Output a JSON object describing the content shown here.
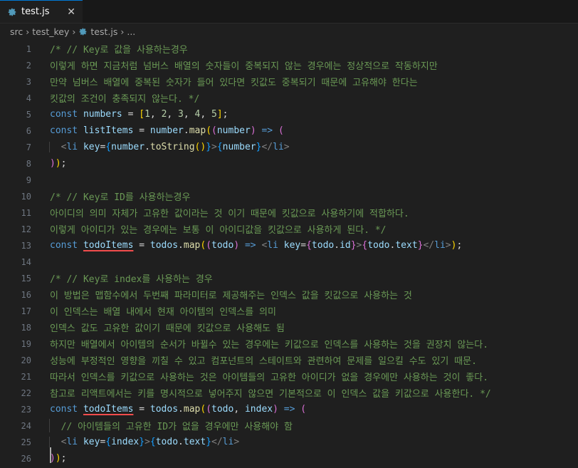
{
  "tab": {
    "label": "test.js",
    "close": "✕"
  },
  "breadcrumb": {
    "src": "src",
    "folder": "test_key",
    "file": "test.js",
    "more": "..."
  },
  "lines": [
    {
      "n": "1",
      "tokens": [
        [
          "cmt",
          "/* // Key로 값을 사용하는경우"
        ]
      ]
    },
    {
      "n": "2",
      "tokens": [
        [
          "cmt",
          "이렇게 하면 지금처럼 넘버스 배열의 숫자들이 중복되지 않는 경우에는 정상적으로 작동하지만"
        ]
      ]
    },
    {
      "n": "3",
      "tokens": [
        [
          "cmt",
          "만약 넘버스 배열에 중복된 숫자가 들어 있다면 킷값도 중복되기 때문에 고유해야 한다는"
        ]
      ]
    },
    {
      "n": "4",
      "tokens": [
        [
          "cmt",
          "킷값의 조건이 충족되지 않는다. */"
        ]
      ]
    },
    {
      "n": "5",
      "tokens": [
        [
          "kw",
          "const "
        ],
        [
          "var",
          "numbers"
        ],
        [
          "plain",
          " = "
        ],
        [
          "b1",
          "["
        ],
        [
          "num",
          "1"
        ],
        [
          "plain",
          ", "
        ],
        [
          "num",
          "2"
        ],
        [
          "plain",
          ", "
        ],
        [
          "num",
          "3"
        ],
        [
          "plain",
          ", "
        ],
        [
          "num",
          "4"
        ],
        [
          "plain",
          ", "
        ],
        [
          "num",
          "5"
        ],
        [
          "b1",
          "]"
        ],
        [
          "plain",
          ";"
        ]
      ]
    },
    {
      "n": "6",
      "tokens": [
        [
          "kw",
          "const "
        ],
        [
          "var",
          "listItems"
        ],
        [
          "plain",
          " = "
        ],
        [
          "var",
          "number"
        ],
        [
          "plain",
          "."
        ],
        [
          "fn",
          "map"
        ],
        [
          "b1",
          "("
        ],
        [
          "b2",
          "("
        ],
        [
          "var",
          "number"
        ],
        [
          "b2",
          ")"
        ],
        [
          "kw",
          " =>"
        ],
        [
          "plain",
          " "
        ],
        [
          "b2",
          "("
        ]
      ]
    },
    {
      "n": "7",
      "indent": true,
      "tokens": [
        [
          "plain",
          "  "
        ],
        [
          "tag",
          "<"
        ],
        [
          "tagname",
          "li"
        ],
        [
          "plain",
          " "
        ],
        [
          "attr",
          "key"
        ],
        [
          "plain",
          "="
        ],
        [
          "b3",
          "{"
        ],
        [
          "var",
          "number"
        ],
        [
          "plain",
          "."
        ],
        [
          "fn",
          "toString"
        ],
        [
          "b1",
          "()"
        ],
        [
          "b3",
          "}"
        ],
        [
          "tag",
          ">"
        ],
        [
          "b3",
          "{"
        ],
        [
          "var",
          "number"
        ],
        [
          "b3",
          "}"
        ],
        [
          "tag",
          "</"
        ],
        [
          "tagname",
          "li"
        ],
        [
          "tag",
          ">"
        ]
      ]
    },
    {
      "n": "8",
      "tokens": [
        [
          "b2",
          ")"
        ],
        [
          "b1",
          ")"
        ],
        [
          "plain",
          ";"
        ]
      ]
    },
    {
      "n": "9",
      "tokens": []
    },
    {
      "n": "10",
      "tokens": [
        [
          "cmt",
          "/* // Key로 ID를 사용하는경우"
        ]
      ]
    },
    {
      "n": "11",
      "tokens": [
        [
          "cmt",
          "아이디의 의미 자체가 고유한 값이라는 것 이기 때문에 킷값으로 사용하기에 적합하다."
        ]
      ]
    },
    {
      "n": "12",
      "tokens": [
        [
          "cmt",
          "이렇게 아이디가 있는 경우에는 보통 이 아이디값을 킷값으로 사용하게 된다. */"
        ]
      ]
    },
    {
      "n": "13",
      "tokens": [
        [
          "kw",
          "const "
        ],
        [
          "var err",
          "todoItems"
        ],
        [
          "plain",
          " = "
        ],
        [
          "var",
          "todos"
        ],
        [
          "plain",
          "."
        ],
        [
          "fn",
          "map"
        ],
        [
          "b1",
          "("
        ],
        [
          "b2",
          "("
        ],
        [
          "var",
          "todo"
        ],
        [
          "b2",
          ")"
        ],
        [
          "kw",
          " =>"
        ],
        [
          "plain",
          " "
        ],
        [
          "tag",
          "<"
        ],
        [
          "tagname",
          "li"
        ],
        [
          "plain",
          " "
        ],
        [
          "attr",
          "key"
        ],
        [
          "plain",
          "="
        ],
        [
          "b2",
          "{"
        ],
        [
          "var",
          "todo"
        ],
        [
          "plain",
          "."
        ],
        [
          "var",
          "id"
        ],
        [
          "b2",
          "}"
        ],
        [
          "tag",
          ">"
        ],
        [
          "b2",
          "{"
        ],
        [
          "var",
          "todo"
        ],
        [
          "plain",
          "."
        ],
        [
          "var",
          "text"
        ],
        [
          "b2",
          "}"
        ],
        [
          "tag",
          "</"
        ],
        [
          "tagname",
          "li"
        ],
        [
          "tag",
          ">"
        ],
        [
          "b1",
          ")"
        ],
        [
          "plain",
          ";"
        ]
      ]
    },
    {
      "n": "14",
      "tokens": []
    },
    {
      "n": "15",
      "tokens": [
        [
          "cmt",
          "/* // Key로 index를 사용하는 경우"
        ]
      ]
    },
    {
      "n": "16",
      "tokens": [
        [
          "cmt",
          "이 방법은 맵함수에서 두번째 파라미터로 제공해주는 인덱스 값을 킷값으로 사용하는 것"
        ]
      ]
    },
    {
      "n": "17",
      "tokens": [
        [
          "cmt",
          "이 인덱스는 배열 내에서 현재 아이템의 인덱스를 의미"
        ]
      ]
    },
    {
      "n": "18",
      "tokens": [
        [
          "cmt",
          "인덱스 값도 고유한 값이기 때문에 킷값으로 사용해도 됨"
        ]
      ]
    },
    {
      "n": "19",
      "tokens": [
        [
          "cmt",
          "하지만 배열에서 아이템의 순서가 바뀔수 있는 경우에는 키값으로 인덱스를 사용하는 것을 권장치 않는다."
        ]
      ]
    },
    {
      "n": "20",
      "tokens": [
        [
          "cmt",
          "성능에 부정적인 영향을 끼칠 수 있고 컴포넌트의 스테이트와 관련하여 문제를 일으킬 수도 있기 때문."
        ]
      ]
    },
    {
      "n": "21",
      "tokens": [
        [
          "cmt",
          "따라서 인덱스를 키값으로 사용하는 것은 아이템들의 고유한 아이디가 없을 경우에만 사용하는 것이 좋다."
        ]
      ]
    },
    {
      "n": "22",
      "tokens": [
        [
          "cmt",
          "참고로 리액트에서는 키를 명시적으로 넣어주지 않으면 기본적으로 이 인덱스 값을 키값으로 사용한다. */"
        ]
      ]
    },
    {
      "n": "23",
      "tokens": [
        [
          "kw",
          "const "
        ],
        [
          "var err",
          "todoItems"
        ],
        [
          "plain",
          " = "
        ],
        [
          "var",
          "todos"
        ],
        [
          "plain",
          "."
        ],
        [
          "fn",
          "map"
        ],
        [
          "b1",
          "("
        ],
        [
          "b2",
          "("
        ],
        [
          "var",
          "todo"
        ],
        [
          "plain",
          ", "
        ],
        [
          "var",
          "index"
        ],
        [
          "b2",
          ")"
        ],
        [
          "kw",
          " =>"
        ],
        [
          "plain",
          " "
        ],
        [
          "b2",
          "("
        ]
      ]
    },
    {
      "n": "24",
      "indent": true,
      "tokens": [
        [
          "plain",
          "  "
        ],
        [
          "cmt",
          "// 아이템들의 고유한 ID가 없을 경우에만 사용해야 함"
        ]
      ]
    },
    {
      "n": "25",
      "indent": true,
      "tokens": [
        [
          "plain",
          "  "
        ],
        [
          "tag",
          "<"
        ],
        [
          "tagname",
          "li"
        ],
        [
          "plain",
          " "
        ],
        [
          "attr",
          "key"
        ],
        [
          "plain",
          "="
        ],
        [
          "b3",
          "{"
        ],
        [
          "var",
          "index"
        ],
        [
          "b3",
          "}"
        ],
        [
          "tag",
          ">"
        ],
        [
          "b3",
          "{"
        ],
        [
          "var",
          "todo"
        ],
        [
          "plain",
          "."
        ],
        [
          "var",
          "text"
        ],
        [
          "b3",
          "}"
        ],
        [
          "tag",
          "</"
        ],
        [
          "tagname",
          "li"
        ],
        [
          "tag",
          ">"
        ]
      ]
    },
    {
      "n": "26",
      "tokens": [
        [
          "b2",
          ")"
        ],
        [
          "b1",
          ")"
        ],
        [
          "plain",
          ";"
        ]
      ]
    }
  ]
}
